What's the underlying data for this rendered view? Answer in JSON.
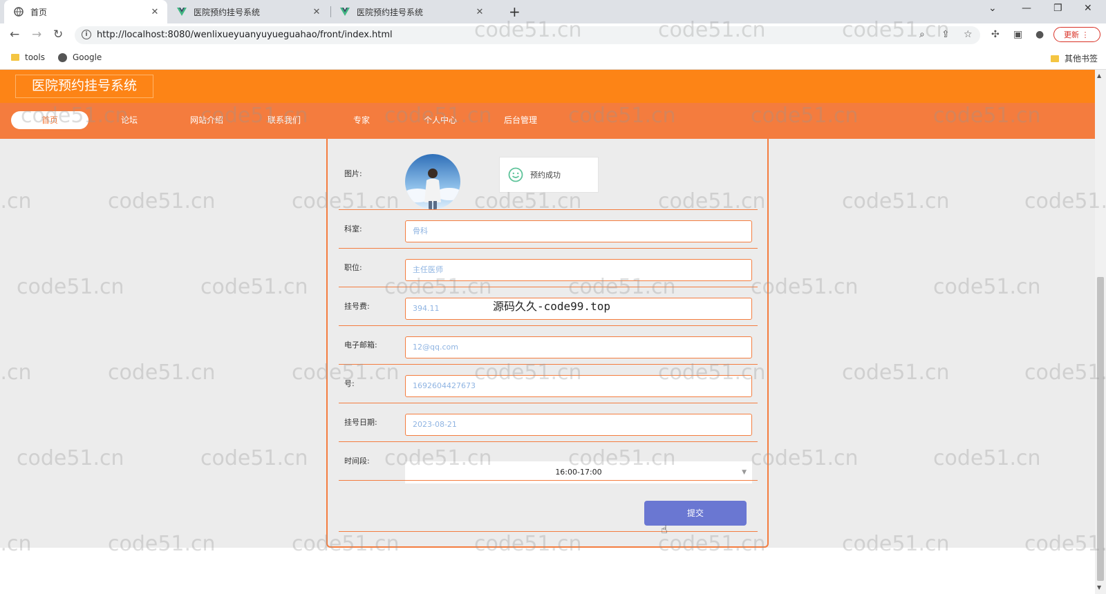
{
  "browser": {
    "tabs": [
      {
        "title": "首页",
        "active": true
      },
      {
        "title": "医院预约挂号系统",
        "active": false
      },
      {
        "title": "医院预约挂号系统",
        "active": false
      }
    ],
    "url": "http://localhost:8080/wenlixueyuanyuyueguahao/front/index.html",
    "update_label": "更新",
    "bookmarks": [
      {
        "label": "tools",
        "icon": "folder-icon"
      },
      {
        "label": "Google",
        "icon": "globe-icon"
      }
    ],
    "other_bookmarks": "其他书签"
  },
  "site": {
    "title": "医院预约挂号系统",
    "nav": [
      "首页",
      "论坛",
      "网站介绍",
      "联系我们",
      "专家",
      "个人中心",
      "后台管理"
    ],
    "active_nav": "首页"
  },
  "form": {
    "image_label": "图片:",
    "toast_message": "预约成功",
    "fields": [
      {
        "label": "科室:",
        "value": "骨科"
      },
      {
        "label": "职位:",
        "value": "主任医师"
      },
      {
        "label": "挂号费:",
        "value": "394.11"
      },
      {
        "label": "电子邮箱:",
        "value": "12@qq.com"
      },
      {
        "label": "号:",
        "value": "1692604427673"
      },
      {
        "label": "挂号日期:",
        "value": "2023-08-21"
      }
    ],
    "time_label": "时间段:",
    "time_value": "16:00-17:00",
    "submit_label": "提交"
  },
  "overlay_text": "源码久久-code99.top",
  "watermark": "code51.cn",
  "colors": {
    "header": "#fd8416",
    "nav": "#f47c3e",
    "submit": "#6a77d2",
    "input_text": "#8fb4e2"
  }
}
